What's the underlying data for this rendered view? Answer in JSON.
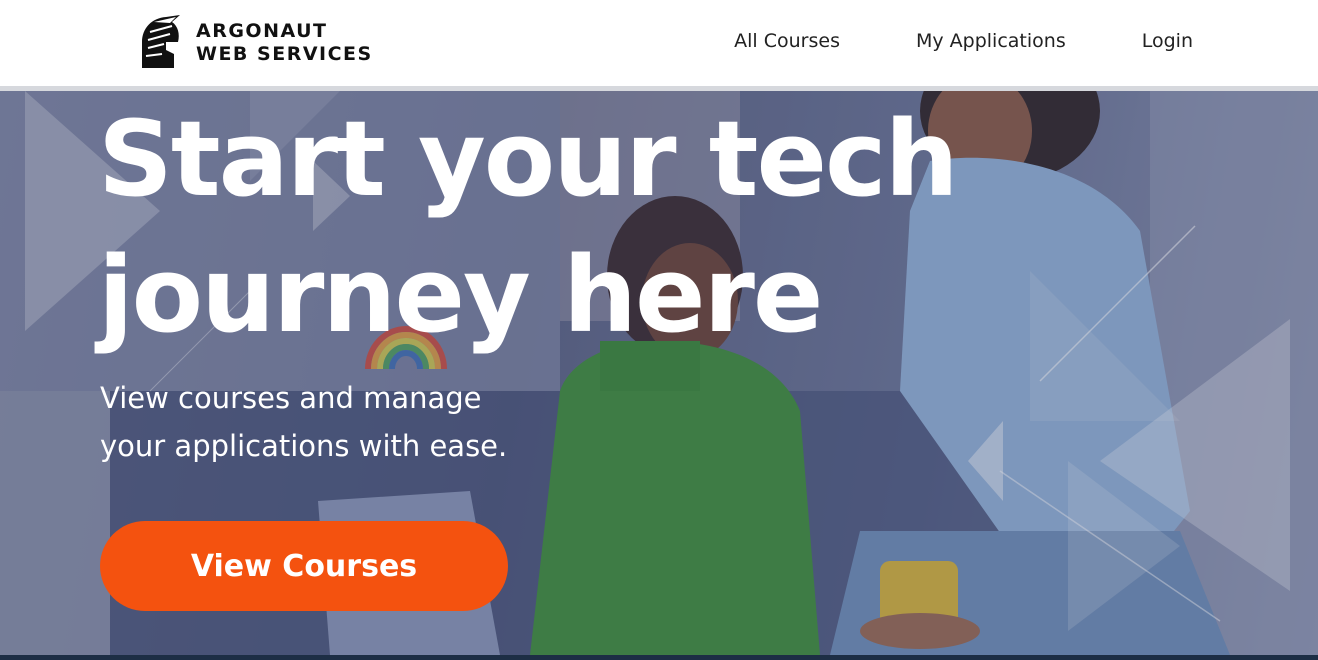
{
  "brand": {
    "line1": "ARGONAUT",
    "line2": "WEB SERVICES",
    "logo_icon": "spartan-helmet-icon"
  },
  "nav": {
    "links": [
      "All Courses",
      "My Applications",
      "Login"
    ]
  },
  "hero": {
    "headline_line1": "Start your tech",
    "headline_line2": "journey here",
    "subtext_line1": "View courses and manage",
    "subtext_line2": "your applications with ease.",
    "cta_label": "View Courses"
  },
  "colors": {
    "accent": "#f4520f",
    "nav_text": "#222222",
    "footer_bar": "#1d2e45"
  }
}
